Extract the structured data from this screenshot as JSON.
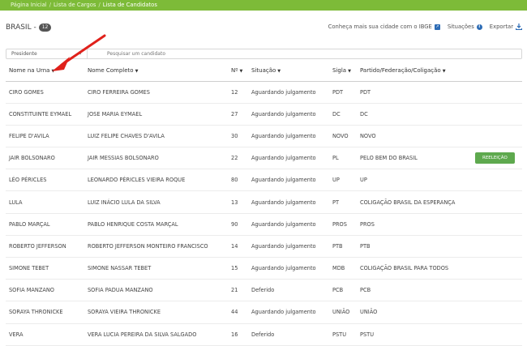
{
  "breadcrumb": [
    "Página Inicial",
    "Lista de Cargos",
    "Lista de Candidatos"
  ],
  "heading": {
    "title": "BRASIL -",
    "count": "12"
  },
  "toplinks": {
    "ibge": "Conheça mais sua cidade com o IBGE",
    "situacoes": "Situações",
    "exportar": "Exportar"
  },
  "filter": {
    "cargo": "Presidente",
    "search_placeholder": "Pesquisar um candidato"
  },
  "columns": {
    "urna": "Nome na Urna",
    "completo": "Nome Completo",
    "numero": "Nº",
    "situacao": "Situação",
    "sigla": "Sigla",
    "partido": "Partido/Federação/Coligação"
  },
  "reeleicao_label": "REELEIÇÃO",
  "rows": [
    {
      "urna": "CIRO GOMES",
      "completo": "CIRO FERREIRA GOMES",
      "numero": "12",
      "situacao": "Aguardando julgamento",
      "sigla": "PDT",
      "partido": "PDT",
      "reeleicao": false
    },
    {
      "urna": "CONSTITUINTE EYMAEL",
      "completo": "JOSE MARIA EYMAEL",
      "numero": "27",
      "situacao": "Aguardando julgamento",
      "sigla": "DC",
      "partido": "DC",
      "reeleicao": false
    },
    {
      "urna": "FELIPE D'AVILA",
      "completo": "LUIZ FELIPE CHAVES D'AVILA",
      "numero": "30",
      "situacao": "Aguardando julgamento",
      "sigla": "NOVO",
      "partido": "NOVO",
      "reeleicao": false
    },
    {
      "urna": "JAIR BOLSONARO",
      "completo": "JAIR MESSIAS BOLSONARO",
      "numero": "22",
      "situacao": "Aguardando julgamento",
      "sigla": "PL",
      "partido": "PELO BEM DO BRASIL",
      "reeleicao": true
    },
    {
      "urna": "LÉO PÉRICLES",
      "completo": "LEONARDO PÉRICLES VIEIRA ROQUE",
      "numero": "80",
      "situacao": "Aguardando julgamento",
      "sigla": "UP",
      "partido": "UP",
      "reeleicao": false
    },
    {
      "urna": "LULA",
      "completo": "LUIZ INÁCIO LULA DA SILVA",
      "numero": "13",
      "situacao": "Aguardando julgamento",
      "sigla": "PT",
      "partido": "COLIGAÇÃO BRASIL DA ESPERANÇA",
      "reeleicao": false
    },
    {
      "urna": "PABLO MARÇAL",
      "completo": "PABLO HENRIQUE COSTA MARÇAL",
      "numero": "90",
      "situacao": "Aguardando julgamento",
      "sigla": "PROS",
      "partido": "PROS",
      "reeleicao": false
    },
    {
      "urna": "ROBERTO JEFFERSON",
      "completo": "ROBERTO JEFFERSON MONTEIRO FRANCISCO",
      "numero": "14",
      "situacao": "Aguardando julgamento",
      "sigla": "PTB",
      "partido": "PTB",
      "reeleicao": false
    },
    {
      "urna": "SIMONE TEBET",
      "completo": "SIMONE NASSAR TEBET",
      "numero": "15",
      "situacao": "Aguardando julgamento",
      "sigla": "MDB",
      "partido": "COLIGAÇÃO BRASIL PARA TODOS",
      "reeleicao": false
    },
    {
      "urna": "SOFIA MANZANO",
      "completo": "SOFIA PADUA MANZANO",
      "numero": "21",
      "situacao": "Deferido",
      "sigla": "PCB",
      "partido": "PCB",
      "reeleicao": false
    },
    {
      "urna": "SORAYA THRONICKE",
      "completo": "SORAYA VIEIRA THRONICKE",
      "numero": "44",
      "situacao": "Aguardando julgamento",
      "sigla": "UNIÃO",
      "partido": "UNIÃO",
      "reeleicao": false
    },
    {
      "urna": "VERA",
      "completo": "VERA LUCIA PEREIRA DA SILVA SALGADO",
      "numero": "16",
      "situacao": "Deferido",
      "sigla": "PSTU",
      "partido": "PSTU",
      "reeleicao": false
    }
  ],
  "colors": {
    "topbar": "#7dbb38",
    "link": "#3a7cc2",
    "badge_green": "#5ea94e",
    "arrow": "#e0211b"
  }
}
